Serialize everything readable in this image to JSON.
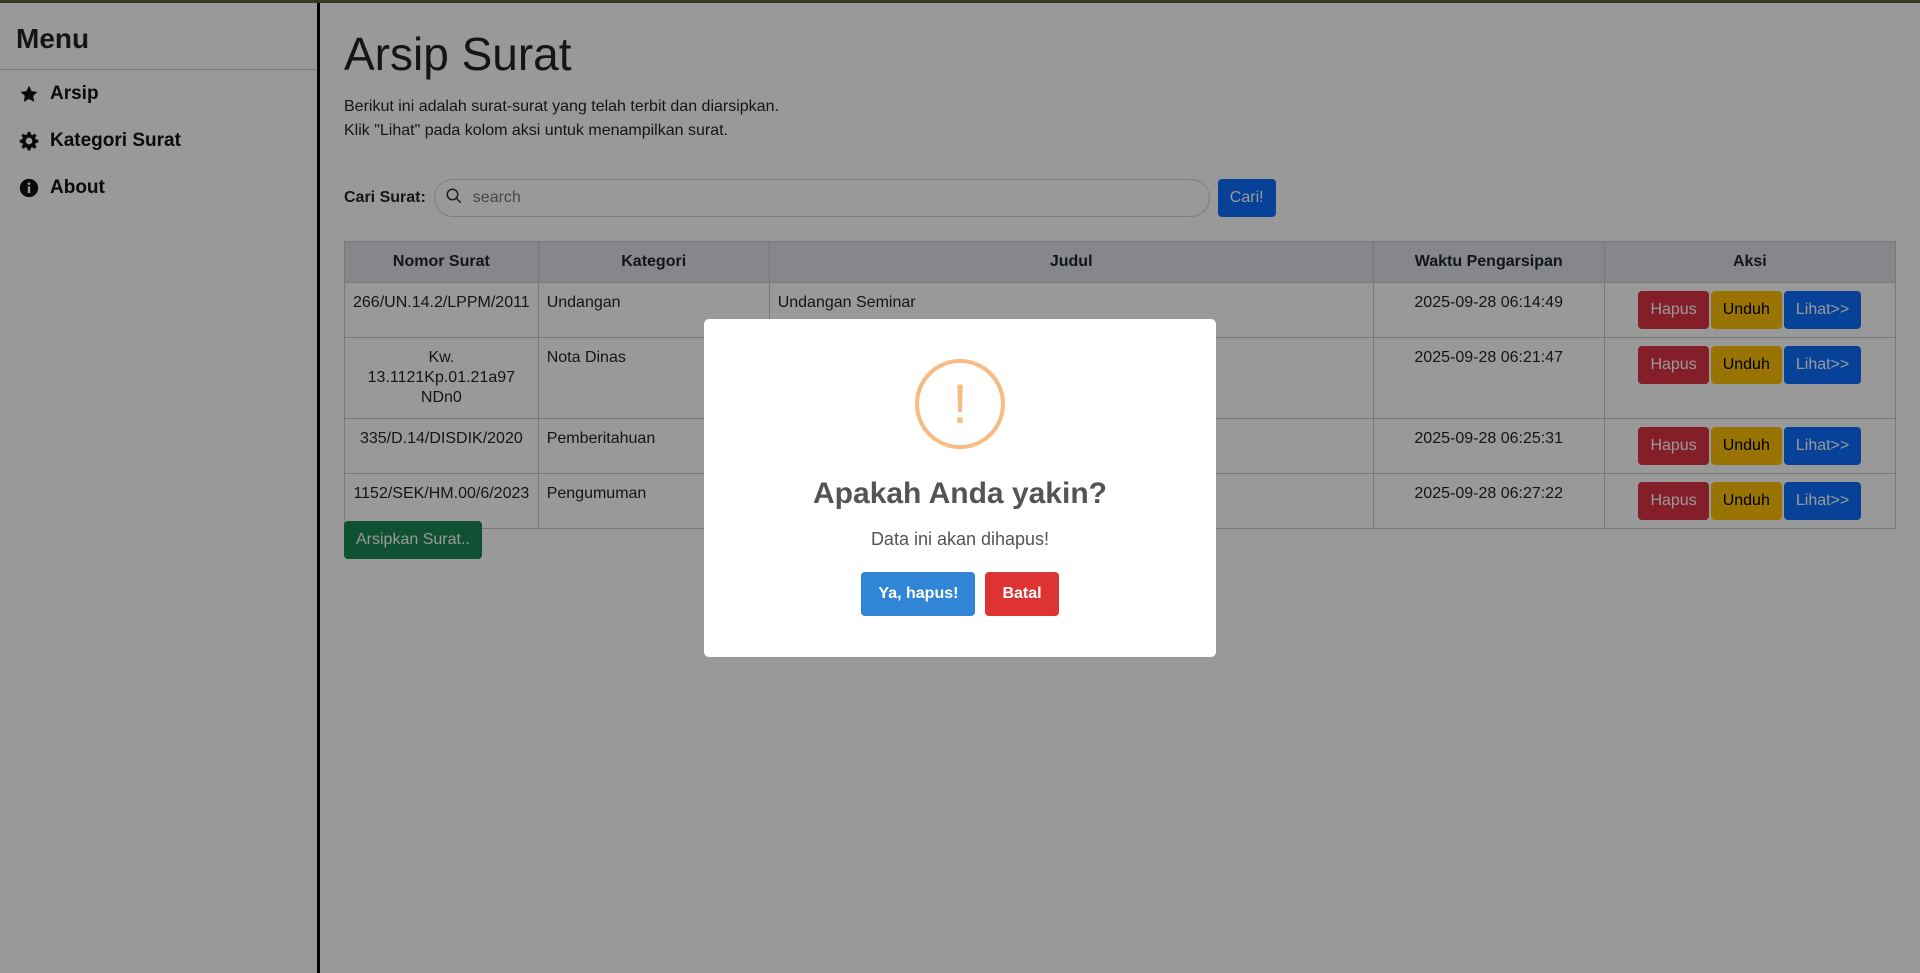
{
  "sidebar": {
    "title": "Menu",
    "items": [
      {
        "label": "Arsip",
        "icon": "star-icon"
      },
      {
        "label": "Kategori Surat",
        "icon": "gear-icon"
      },
      {
        "label": "About",
        "icon": "info-icon"
      }
    ]
  },
  "main": {
    "title": "Arsip Surat",
    "description": [
      "Berikut ini adalah surat-surat yang telah terbit dan diarsipkan.",
      "Klik \"Lihat\" pada kolom aksi untuk menampilkan surat."
    ],
    "search": {
      "label": "Cari Surat:",
      "placeholder": "search",
      "value": "",
      "button": "Cari!"
    },
    "table": {
      "headers": [
        "Nomor Surat",
        "Kategori",
        "Judul",
        "Waktu Pengarsipan",
        "Aksi"
      ],
      "rows": [
        {
          "nomor": "266/UN.14.2/LPPM/2011",
          "kategori": "Undangan",
          "judul": "Undangan Seminar",
          "waktu": "2025-09-28 06:14:49"
        },
        {
          "nomor": "Kw. 13.1121Kp.01.21a97 NDn0",
          "kategori": "Nota Dinas",
          "judul": "",
          "waktu": "2025-09-28 06:21:47"
        },
        {
          "nomor": "335/D.14/DISDIK/2020",
          "kategori": "Pemberitahuan",
          "judul": "",
          "waktu": "2025-09-28 06:25:31"
        },
        {
          "nomor": "1152/SEK/HM.00/6/2023",
          "kategori": "Pengumuman",
          "judul": "",
          "waktu": "2025-09-28 06:27:22"
        }
      ],
      "actions": {
        "delete": "Hapus",
        "download": "Unduh",
        "view": "Lihat>>"
      }
    },
    "archive_button": "Arsipkan Surat.."
  },
  "modal": {
    "icon": "!",
    "title": "Apakah Anda yakin?",
    "text": "Data ini akan dihapus!",
    "confirm": "Ya, hapus!",
    "cancel": "Batal"
  },
  "colors": {
    "primary": "#0d6efd",
    "danger": "#dc3545",
    "warning": "#ffc107",
    "success": "#198754",
    "modal_confirm": "#3085d6",
    "modal_cancel": "#dd3333",
    "warning_icon": "#f8bb86"
  }
}
